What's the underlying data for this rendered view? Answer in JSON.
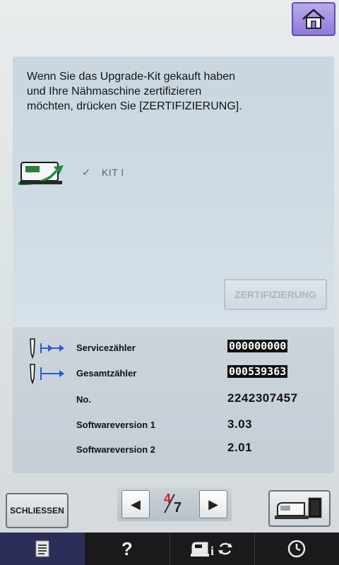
{
  "header": {
    "home_icon": "house-icon"
  },
  "message": {
    "line1": "Wenn Sie das Upgrade-Kit gekauft haben",
    "line2": "und Ihre Nähmaschine zertifizieren",
    "line3": "möchten, drücken Sie [ZERTIFIZIERUNG]."
  },
  "kit": {
    "check": "✓",
    "label": "KIT I",
    "icon": "sewing-machine-upgrade-icon"
  },
  "certify_button": {
    "label": "ZERTIFIZIERUNG",
    "state": "disabled"
  },
  "info": {
    "service_counter": {
      "label": "Servicezähler",
      "value": "000000000"
    },
    "total_counter": {
      "label": "Gesamtzähler",
      "value": "000539363"
    },
    "number": {
      "label": "No.",
      "value": "2242307457"
    },
    "software1": {
      "label": "Softwareversion 1",
      "value": "3.03"
    },
    "software2": {
      "label": "Softwareversion 2",
      "value": "2.01"
    }
  },
  "footer": {
    "close_label": "SCHLIESSEN",
    "pager": {
      "current": "4",
      "total": "7"
    }
  },
  "taskbar": {
    "help_label": "?"
  },
  "colors": {
    "accent": "#8f7ad8",
    "page_current": "#d0202a",
    "taskbar_active": "#2c2d58"
  }
}
